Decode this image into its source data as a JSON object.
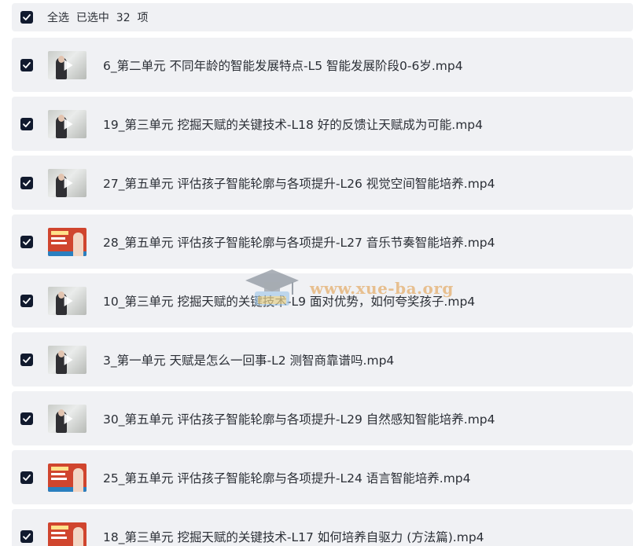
{
  "header": {
    "select_all_text": "全选  已选中  32  项",
    "checked": true
  },
  "files": [
    {
      "name": "6_第二单元 不同年龄的智能发展特点-L5 智能发展阶段0-6岁.mp4",
      "thumb": "photo",
      "checked": true
    },
    {
      "name": "19_第三单元 挖掘天赋的关键技术-L18 好的反馈让天赋成为可能.mp4",
      "thumb": "photo",
      "checked": true
    },
    {
      "name": "27_第五单元 评估孩子智能轮廓与各项提升-L26 视觉空间智能培养.mp4",
      "thumb": "photo",
      "checked": true
    },
    {
      "name": "28_第五单元 评估孩子智能轮廓与各项提升-L27 音乐节奏智能培养.mp4",
      "thumb": "poster",
      "checked": true
    },
    {
      "name": "10_第三单元 挖掘天赋的关键技术-L9 面对优势，如何夸奖孩子.mp4",
      "thumb": "photo",
      "checked": true
    },
    {
      "name": "3_第一单元  天赋是怎么一回事-L2 测智商靠谱吗.mp4",
      "thumb": "photo",
      "checked": true
    },
    {
      "name": "30_第五单元 评估孩子智能轮廓与各项提升-L29 自然感知智能培养.mp4",
      "thumb": "photo",
      "checked": true
    },
    {
      "name": "25_第五单元 评估孩子智能轮廓与各项提升-L24 语言智能培养.mp4",
      "thumb": "poster",
      "checked": true
    },
    {
      "name": "18_第三单元 挖掘天赋的关键技术-L17 如何培养自驱力 (方法篇).mp4",
      "thumb": "poster",
      "checked": true
    }
  ],
  "watermark": {
    "text": "www.xue-ba.org",
    "icon": "graduation-cap-icon"
  },
  "colors": {
    "row_background": "#f0f1f4",
    "checkbox": "#111a2e",
    "text": "#2b2f36",
    "poster_red": "#d0452e"
  }
}
